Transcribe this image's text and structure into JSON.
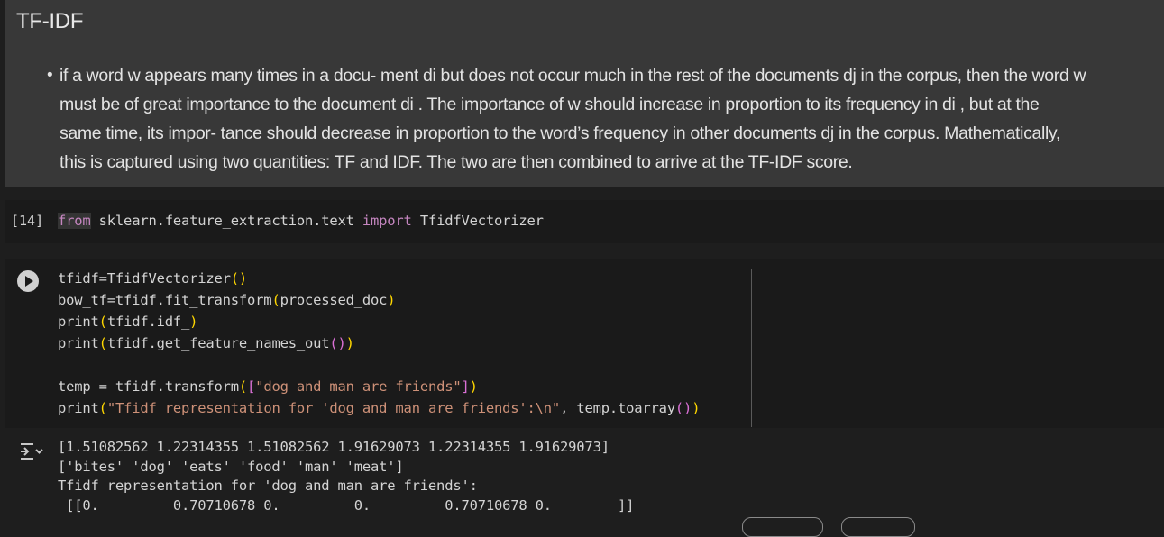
{
  "markdown": {
    "title": "TF-IDF",
    "bullet_line1": "if a word w appears many times in a docu- ment di but does not occur much in the rest of the documents dj in the corpus, then the word w",
    "bullet_line2": "must be of great importance to the document di . The importance of w should increase in proportion to its frequency in di , but at the",
    "bullet_line3": "same time, its impor- tance should decrease in proportion to the word’s frequency in other documents dj in the corpus. Mathematically,",
    "bullet_line4": "this is captured using two quantities: TF and IDF. The two are then combined to arrive at the TF-IDF score."
  },
  "cell1": {
    "exec_count": "[14]",
    "kw_from": "from",
    "module": " sklearn.feature_extraction.text ",
    "kw_import": "import",
    "name": " TfidfVectorizer"
  },
  "cell2": {
    "line1": "tfidf=TfidfVectorizer",
    "line1_paren": "()",
    "line2a": "bow_tf=tfidf.fit_transform",
    "line2_open": "(",
    "line2_arg": "processed_doc",
    "line2_close": ")",
    "line3a": "print",
    "line3_open": "(",
    "line3_arg": "tfidf.idf_",
    "line3_close": ")",
    "line4a": "print",
    "line4_open": "(",
    "line4_arg": "tfidf.get_feature_names_out",
    "line4_inner": "()",
    "line4_close": ")",
    "line6a": "temp = tfidf.transform",
    "line6_open": "(",
    "line6_bracket_open": "[",
    "line6_str": "\"dog and man are friends\"",
    "line6_bracket_close": "]",
    "line6_close": ")",
    "line7a": "print",
    "line7_open": "(",
    "line7_str": "\"Tfidf representation for 'dog and man are friends':\\n\"",
    "line7_mid": ", temp.toarray",
    "line7_inner": "()",
    "line7_close": ")"
  },
  "output": {
    "line1": "[1.51082562 1.22314355 1.51082562 1.91629073 1.22314355 1.91629073]",
    "line2": "['bites' 'dog' 'eats' 'food' 'man' 'meat']",
    "line3": "Tfidf representation for 'dog and man are friends':",
    "line4": " [[0.         0.70710678 0.         0.         0.70710678 0.        ]]"
  },
  "icons": {
    "run": "play-circle-icon",
    "output": "output-toggle-icon"
  }
}
